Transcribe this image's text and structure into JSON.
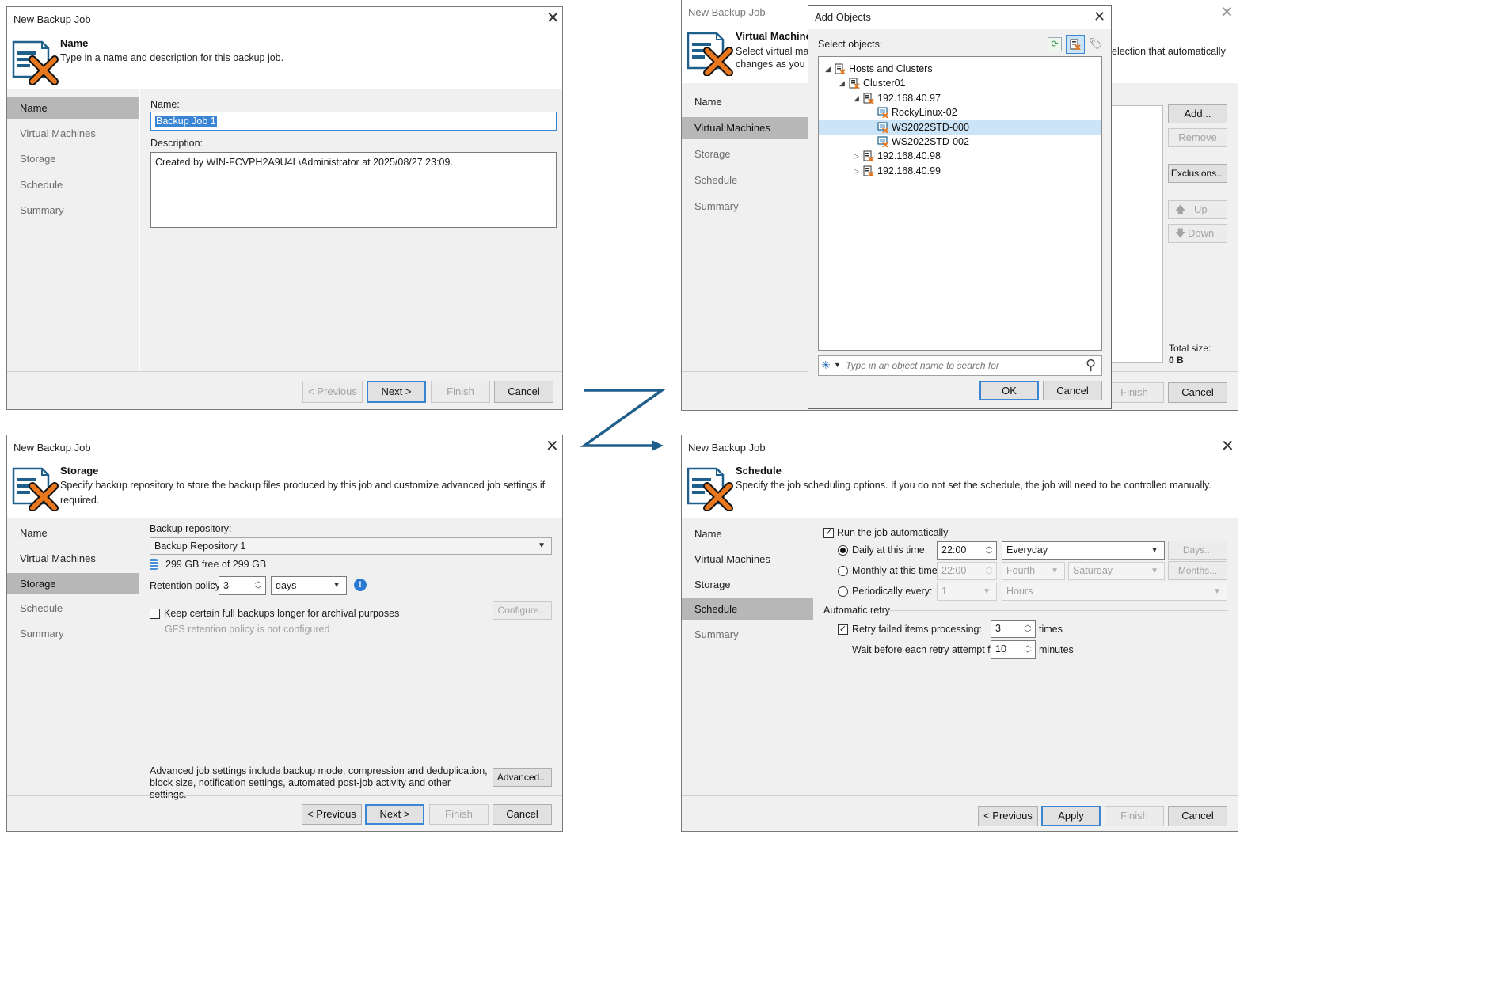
{
  "window_title": "New Backup Job",
  "buttons": {
    "previous": "< Previous",
    "next": "Next >",
    "finish": "Finish",
    "cancel": "Cancel",
    "apply": "Apply",
    "ok": "OK"
  },
  "nav": {
    "name": "Name",
    "virtual_machines": "Virtual Machines",
    "storage": "Storage",
    "schedule": "Schedule",
    "summary": "Summary"
  },
  "panel_name": {
    "title": "Name",
    "description": "Type in a name and description for this backup job.",
    "name_label": "Name:",
    "name_value": "Backup Job 1",
    "desc_label": "Description:",
    "desc_value": "Created by WIN-FCVPH2A9U4L\\Administrator at 2025/08/27 23:09."
  },
  "panel_vm": {
    "title": "Virtual Machines",
    "desc_line1": "Select virtual mach",
    "desc_line2": "changes as you ad",
    "desc_right": "election that automatically",
    "add": "Add...",
    "remove": "Remove",
    "exclusions": "Exclusions...",
    "up": "Up",
    "down": "Down",
    "total_size_label": "Total size:",
    "total_size_value": "0 B"
  },
  "add_objects": {
    "title": "Add Objects",
    "select_label": "Select objects:",
    "tree": [
      {
        "label": "Hosts and Clusters",
        "level": 0,
        "expanded": true,
        "icon": "datacenter-icon"
      },
      {
        "label": "Cluster01",
        "level": 1,
        "expanded": true,
        "icon": "cluster-icon"
      },
      {
        "label": "192.168.40.97",
        "level": 2,
        "expanded": true,
        "icon": "host-icon"
      },
      {
        "label": "RockyLinux-02",
        "level": 3,
        "icon": "vm-icon"
      },
      {
        "label": "WS2022STD-000",
        "level": 3,
        "icon": "vm-icon",
        "selected": true
      },
      {
        "label": "WS2022STD-002",
        "level": 3,
        "icon": "vm-icon"
      },
      {
        "label": "192.168.40.98",
        "level": 2,
        "expanded": false,
        "icon": "host-icon"
      },
      {
        "label": "192.168.40.99",
        "level": 2,
        "expanded": false,
        "icon": "host-icon"
      }
    ],
    "search_placeholder": "Type in an object name to search for"
  },
  "panel_storage": {
    "title": "Storage",
    "description": "Specify backup repository to store the backup files produced by this job and customize advanced job settings if required.",
    "repo_label": "Backup repository:",
    "repo_value": "Backup Repository 1",
    "repo_free": "299 GB free of 299 GB",
    "retention_label": "Retention policy:",
    "retention_value": "3",
    "retention_unit": "days",
    "keep_full_label": "Keep certain full backups longer for archival purposes",
    "configure": "Configure...",
    "gfs_note": "GFS retention policy is not configured",
    "advanced_text": "Advanced job settings include backup mode, compression and deduplication, block size, notification settings, automated post-job activity and other settings.",
    "advanced": "Advanced..."
  },
  "panel_schedule": {
    "title": "Schedule",
    "description": "Specify the job scheduling options. If you do not set the schedule, the job will need to be controlled manually.",
    "run_auto": "Run the job automatically",
    "daily_label": "Daily at this time:",
    "daily_time": "22:00",
    "daily_option": "Everyday",
    "days_button": "Days...",
    "monthly_label": "Monthly at this time:",
    "monthly_time": "22:00",
    "monthly_week": "Fourth",
    "monthly_day": "Saturday",
    "months_button": "Months...",
    "periodic_label": "Periodically every:",
    "periodic_value": "1",
    "periodic_unit": "Hours",
    "auto_retry": "Automatic retry",
    "retry_label": "Retry failed items processing:",
    "retry_value": "3",
    "retry_unit": "times",
    "wait_label": "Wait before each retry attempt for:",
    "wait_value": "10",
    "wait_unit": "minutes"
  },
  "colors": {
    "accent_blue": "#1e5f8c",
    "selection": "#cce4f7",
    "active_nav": "#b7b7b7",
    "logo_orange": "#e8771e"
  }
}
